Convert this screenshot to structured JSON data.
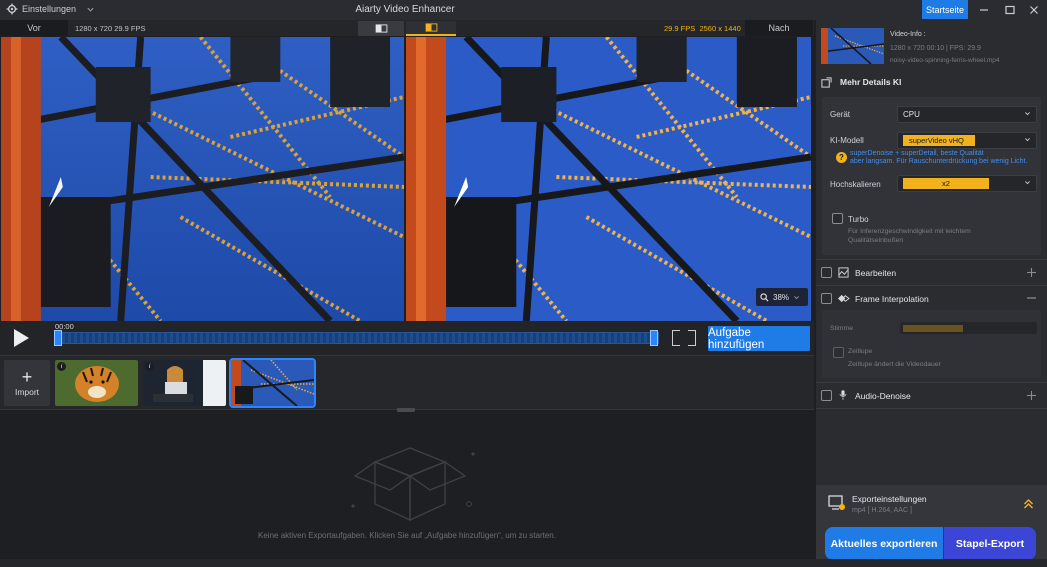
{
  "titlebar": {
    "settings_label": "Einstellungen",
    "title": "Aiarty Video Enhancer",
    "home_label": "Startseite"
  },
  "preview": {
    "before_label": "Vor",
    "after_label": "Nach",
    "source_info": "1280 x 720  29.9 FPS",
    "output_fps": "29.9 FPS",
    "output_res": "2560 x 1440",
    "zoom": "38%"
  },
  "playback": {
    "time": "00:00",
    "add_task_label": "Aufgabe hinzufügen"
  },
  "clips": {
    "import_label": "Import"
  },
  "export_queue": {
    "empty_text": "Keine aktiven Exportaufgaben. Klicken Sie auf „Aufgabe hinzufügen“, um zu starten."
  },
  "video_info": {
    "title": "Video-Info :",
    "meta": "1280 x 720  00:10  |  FPS: 29.9",
    "file": "noisy-video-spinning-ferris-wheel.mp4"
  },
  "ai": {
    "section_title": "Mehr Details KI",
    "device_label": "Gerät",
    "device_value": "CPU",
    "model_label": "KI-Modell",
    "model_value": "superVideo vHQ",
    "model_note_1": "superDenoise + superDetail, beste Qualität",
    "model_note_2": "aber langsam. Für Rauschunterdrückung bei wenig Licht.",
    "scale_label": "Hochskalieren",
    "scale_value": "x2",
    "turbo_label": "Turbo",
    "turbo_note_1": "Für Inferenzgeschwindigkeit mit leichtem",
    "turbo_note_2": "Qualitätseinbußen"
  },
  "sections": {
    "edit_label": "Bearbeiten",
    "fi_label": "Frame Interpolation",
    "fi_speed_label": "Stimme",
    "fi_slowmo_label": "Zeitlupe",
    "fi_slowmo_note": "Zeitlupe ändert die Videodauer",
    "audio_label": "Audio-Denoise"
  },
  "export": {
    "title": "Exporteinstellungen",
    "sub": "mp4 [ H.264, AAC ]",
    "current_label": "Aktuelles exportieren",
    "batch_label": "Stapel-Export"
  },
  "colors": {
    "accent": "#1f7be6",
    "highlight": "#f2b21b",
    "batch": "#3b46d6"
  }
}
